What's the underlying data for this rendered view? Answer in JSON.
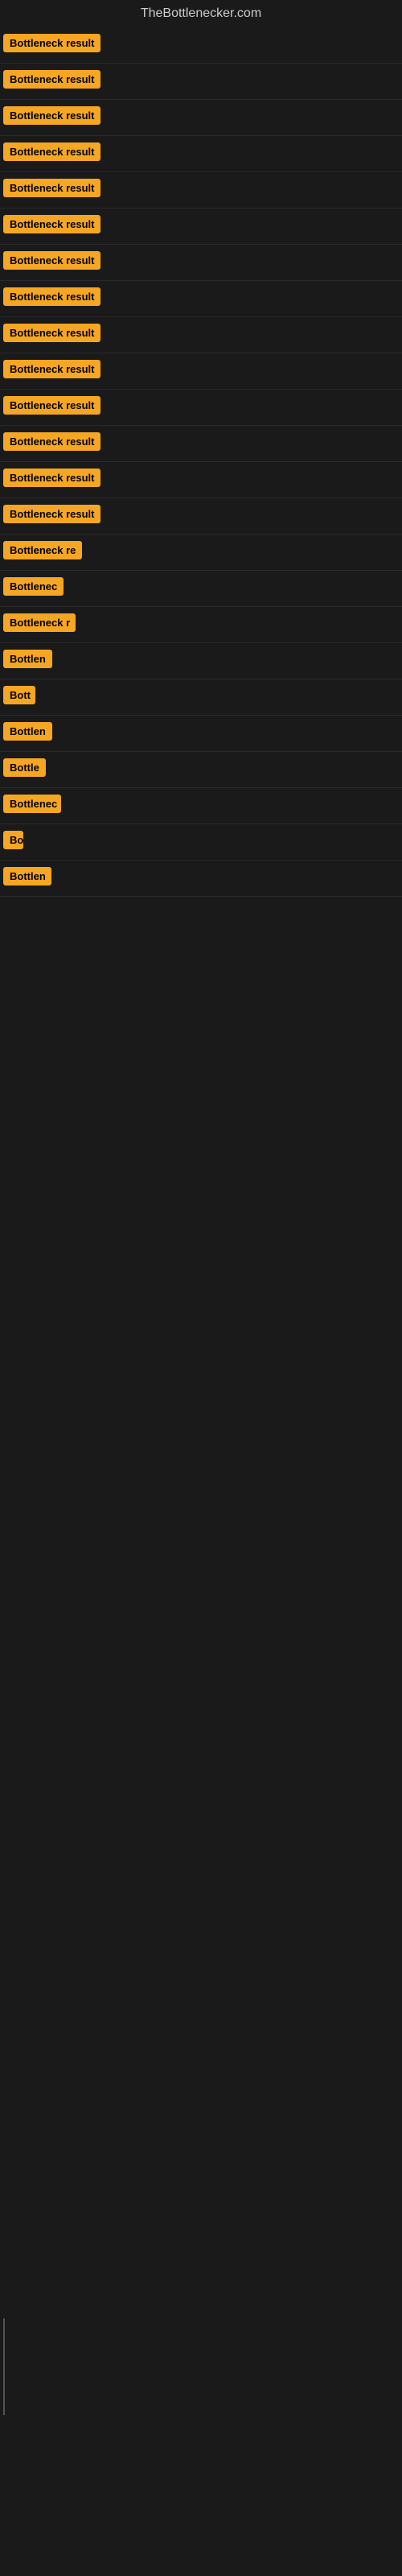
{
  "site": {
    "title": "TheBottlenecker.com"
  },
  "badges": [
    {
      "id": 1,
      "text": "Bottleneck result",
      "width": 130
    },
    {
      "id": 2,
      "text": "Bottleneck result",
      "width": 130
    },
    {
      "id": 3,
      "text": "Bottleneck result",
      "width": 130
    },
    {
      "id": 4,
      "text": "Bottleneck result",
      "width": 130
    },
    {
      "id": 5,
      "text": "Bottleneck result",
      "width": 130
    },
    {
      "id": 6,
      "text": "Bottleneck result",
      "width": 130
    },
    {
      "id": 7,
      "text": "Bottleneck result",
      "width": 130
    },
    {
      "id": 8,
      "text": "Bottleneck result",
      "width": 130
    },
    {
      "id": 9,
      "text": "Bottleneck result",
      "width": 130
    },
    {
      "id": 10,
      "text": "Bottleneck result",
      "width": 130
    },
    {
      "id": 11,
      "text": "Bottleneck result",
      "width": 130
    },
    {
      "id": 12,
      "text": "Bottleneck result",
      "width": 130
    },
    {
      "id": 13,
      "text": "Bottleneck result",
      "width": 130
    },
    {
      "id": 14,
      "text": "Bottleneck result",
      "width": 130
    },
    {
      "id": 15,
      "text": "Bottleneck re",
      "width": 100
    },
    {
      "id": 16,
      "text": "Bottlenec",
      "width": 75
    },
    {
      "id": 17,
      "text": "Bottleneck r",
      "width": 90
    },
    {
      "id": 18,
      "text": "Bottlen",
      "width": 65
    },
    {
      "id": 19,
      "text": "Bott",
      "width": 40
    },
    {
      "id": 20,
      "text": "Bottlen",
      "width": 65
    },
    {
      "id": 21,
      "text": "Bottle",
      "width": 55
    },
    {
      "id": 22,
      "text": "Bottlenec",
      "width": 72
    },
    {
      "id": 23,
      "text": "Bo",
      "width": 25
    },
    {
      "id": 24,
      "text": "Bottlen",
      "width": 60
    }
  ]
}
